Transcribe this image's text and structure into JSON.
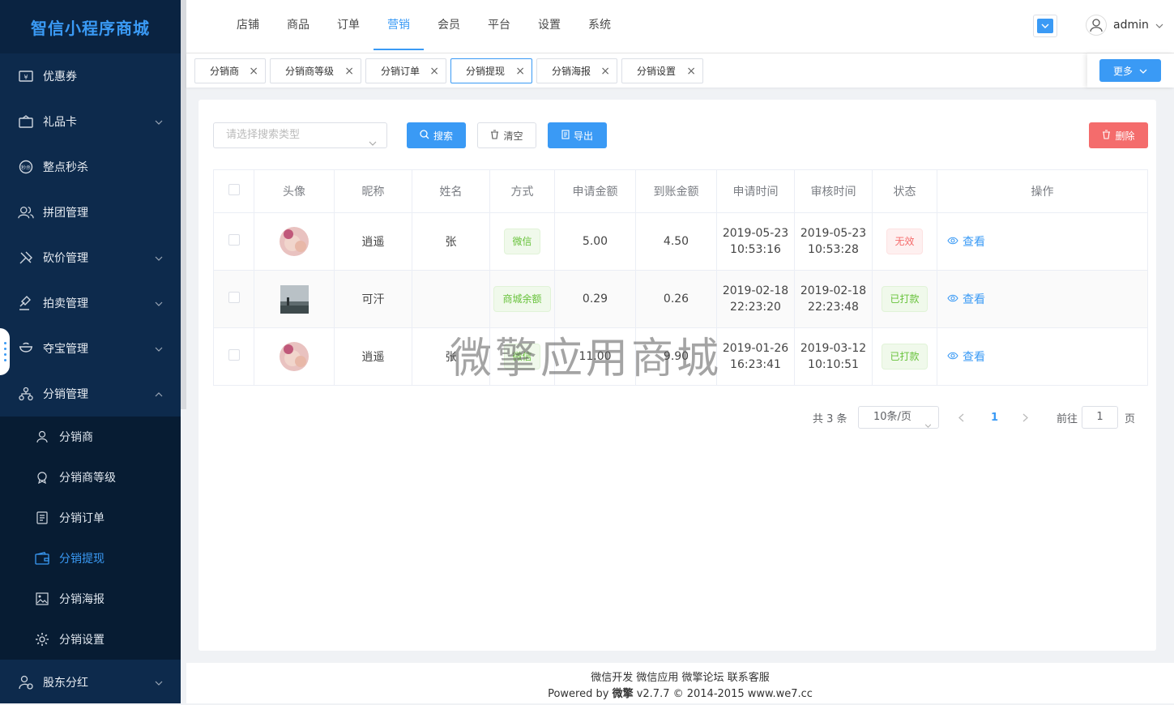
{
  "brand": "智信小程序商城",
  "sidebar": {
    "items": [
      {
        "label": "优惠券",
        "icon": "coupon-icon",
        "arrow": ""
      },
      {
        "label": "礼品卡",
        "icon": "gift-card-icon",
        "arrow": "down"
      },
      {
        "label": "整点秒杀",
        "icon": "flash-sale-icon",
        "arrow": ""
      },
      {
        "label": "拼团管理",
        "icon": "group-buy-icon",
        "arrow": ""
      },
      {
        "label": "砍价管理",
        "icon": "bargain-icon",
        "arrow": "down"
      },
      {
        "label": "拍卖管理",
        "icon": "auction-icon",
        "arrow": "down"
      },
      {
        "label": "夺宝管理",
        "icon": "treasure-icon",
        "arrow": "down"
      },
      {
        "label": "分销管理",
        "icon": "distribution-icon",
        "arrow": "up"
      }
    ],
    "subitems": [
      {
        "label": "分销商",
        "icon": "user-icon"
      },
      {
        "label": "分销商等级",
        "icon": "medal-icon"
      },
      {
        "label": "分销订单",
        "icon": "order-icon"
      },
      {
        "label": "分销提现",
        "icon": "wallet-icon"
      },
      {
        "label": "分销海报",
        "icon": "image-icon"
      },
      {
        "label": "分销设置",
        "icon": "gear-icon"
      }
    ],
    "last_item": {
      "label": "股东分红",
      "icon": "shareholder-icon"
    }
  },
  "topnav": [
    "店铺",
    "商品",
    "订单",
    "营销",
    "会员",
    "平台",
    "设置",
    "系统"
  ],
  "user": {
    "name": "admin"
  },
  "tabs": [
    "分销商",
    "分销商等级",
    "分销订单",
    "分销提现",
    "分销海报",
    "分销设置"
  ],
  "more_label": "更多",
  "toolbar": {
    "search_placeholder": "请选择搜索类型",
    "search_label": "搜索",
    "clear_label": "清空",
    "export_label": "导出",
    "delete_label": "删除"
  },
  "table": {
    "headers": [
      "头像",
      "昵称",
      "姓名",
      "方式",
      "申请金额",
      "到账金额",
      "申请时间",
      "审核时间",
      "状态",
      "操作"
    ],
    "rows": [
      {
        "nickname": "逍遥",
        "name": "张",
        "method": "微信",
        "apply_amount": "5.00",
        "received_amount": "4.50",
        "apply_date": "2019-05-23",
        "apply_time": "10:53:16",
        "review_date": "2019-05-23",
        "review_time": "10:53:28",
        "status": "无效",
        "action": "查看"
      },
      {
        "nickname": "可汗",
        "name": "",
        "method": "商城余额",
        "apply_amount": "0.29",
        "received_amount": "0.26",
        "apply_date": "2019-02-18",
        "apply_time": "22:23:20",
        "review_date": "2019-02-18",
        "review_time": "22:23:48",
        "status": "已打款",
        "action": "查看"
      },
      {
        "nickname": "逍遥",
        "name": "张",
        "method": "微信",
        "apply_amount": "11.00",
        "received_amount": "9.90",
        "apply_date": "2019-01-26",
        "apply_time": "16:23:41",
        "review_date": "2019-03-12",
        "review_time": "10:10:51",
        "status": "已打款",
        "action": "查看"
      }
    ]
  },
  "pagination": {
    "total": "共 3 条",
    "page_size": "10条/页",
    "current": "1",
    "goto_label": "前往",
    "goto_value": "1",
    "page_suffix": "页"
  },
  "watermark": "微擎应用商城",
  "footer": {
    "links": "微信开发 微信应用 微擎论坛 联系客服",
    "powered_prefix": "Powered by ",
    "powered_brand": "微擎",
    "powered_suffix": " v2.7.7 © 2014-2015 www.we7.cc"
  },
  "colors": {
    "accent": "#3a9af5",
    "sidebar_bg": "#0d2a4c",
    "danger": "#f46c6c",
    "success": "#67c23a"
  }
}
